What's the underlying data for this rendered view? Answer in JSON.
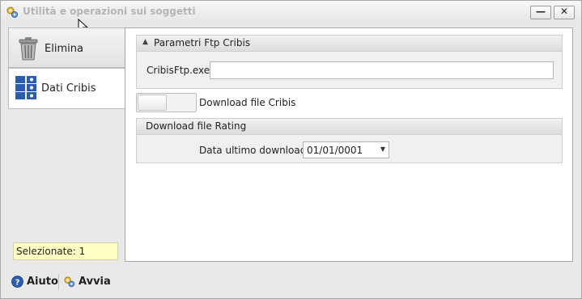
{
  "window": {
    "title": "Utilità e operazioni sui soggetti",
    "minimize_glyph": "—",
    "close_glyph": "✕"
  },
  "nav": {
    "items": [
      {
        "label": "Elimina",
        "icon": "trash-icon"
      },
      {
        "label": "Dati Cribis",
        "icon": "grid-icon",
        "selected": true
      }
    ]
  },
  "status": {
    "selected_text": "Selezionate: 1"
  },
  "section_ftp": {
    "title": "Parametri Ftp Cribis",
    "field_label": "CribisFtp.exe",
    "field_value": ""
  },
  "toggle": {
    "label": "Download file Cribis",
    "on": false
  },
  "section_rating": {
    "title": "Download file Rating",
    "date_label": "Data ultimo download",
    "date_value": "01/01/0001"
  },
  "footer": {
    "help_label": "Aiuto",
    "run_label": "Avvia"
  },
  "colors": {
    "accent_blue": "#2a5db0",
    "note_bg": "#ffffc4"
  }
}
